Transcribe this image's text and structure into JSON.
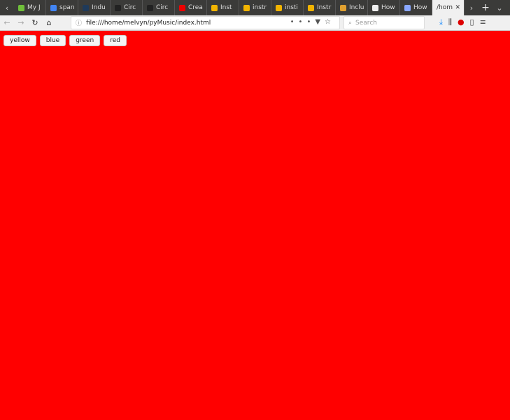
{
  "tabs": [
    {
      "label": "My J",
      "color": "#6fbf3a"
    },
    {
      "label": "span",
      "color": "#4285f4"
    },
    {
      "label": "Indu",
      "color": "#1f3a5a"
    },
    {
      "label": "Circ",
      "color": "#222"
    },
    {
      "label": "Circ",
      "color": "#222"
    },
    {
      "label": "Crea",
      "color": "#e00"
    },
    {
      "label": "Inst",
      "color": "#f2b400"
    },
    {
      "label": "instr",
      "color": "#f2b400"
    },
    {
      "label": "insti",
      "color": "#f2b400"
    },
    {
      "label": "Instr",
      "color": "#f2b400"
    },
    {
      "label": "Inclu",
      "color": "#e0a030"
    },
    {
      "label": "How",
      "color": "#eee"
    },
    {
      "label": "How",
      "color": "#8aa8ff"
    }
  ],
  "active_tab": {
    "label": "/hom",
    "close": "✕"
  },
  "url": "file:///home/melvyn/pyMusic/index.html",
  "search_placeholder": "Search",
  "page": {
    "buttons": [
      "yellow",
      "blue",
      "green",
      "red"
    ],
    "background": "#ff0000"
  }
}
